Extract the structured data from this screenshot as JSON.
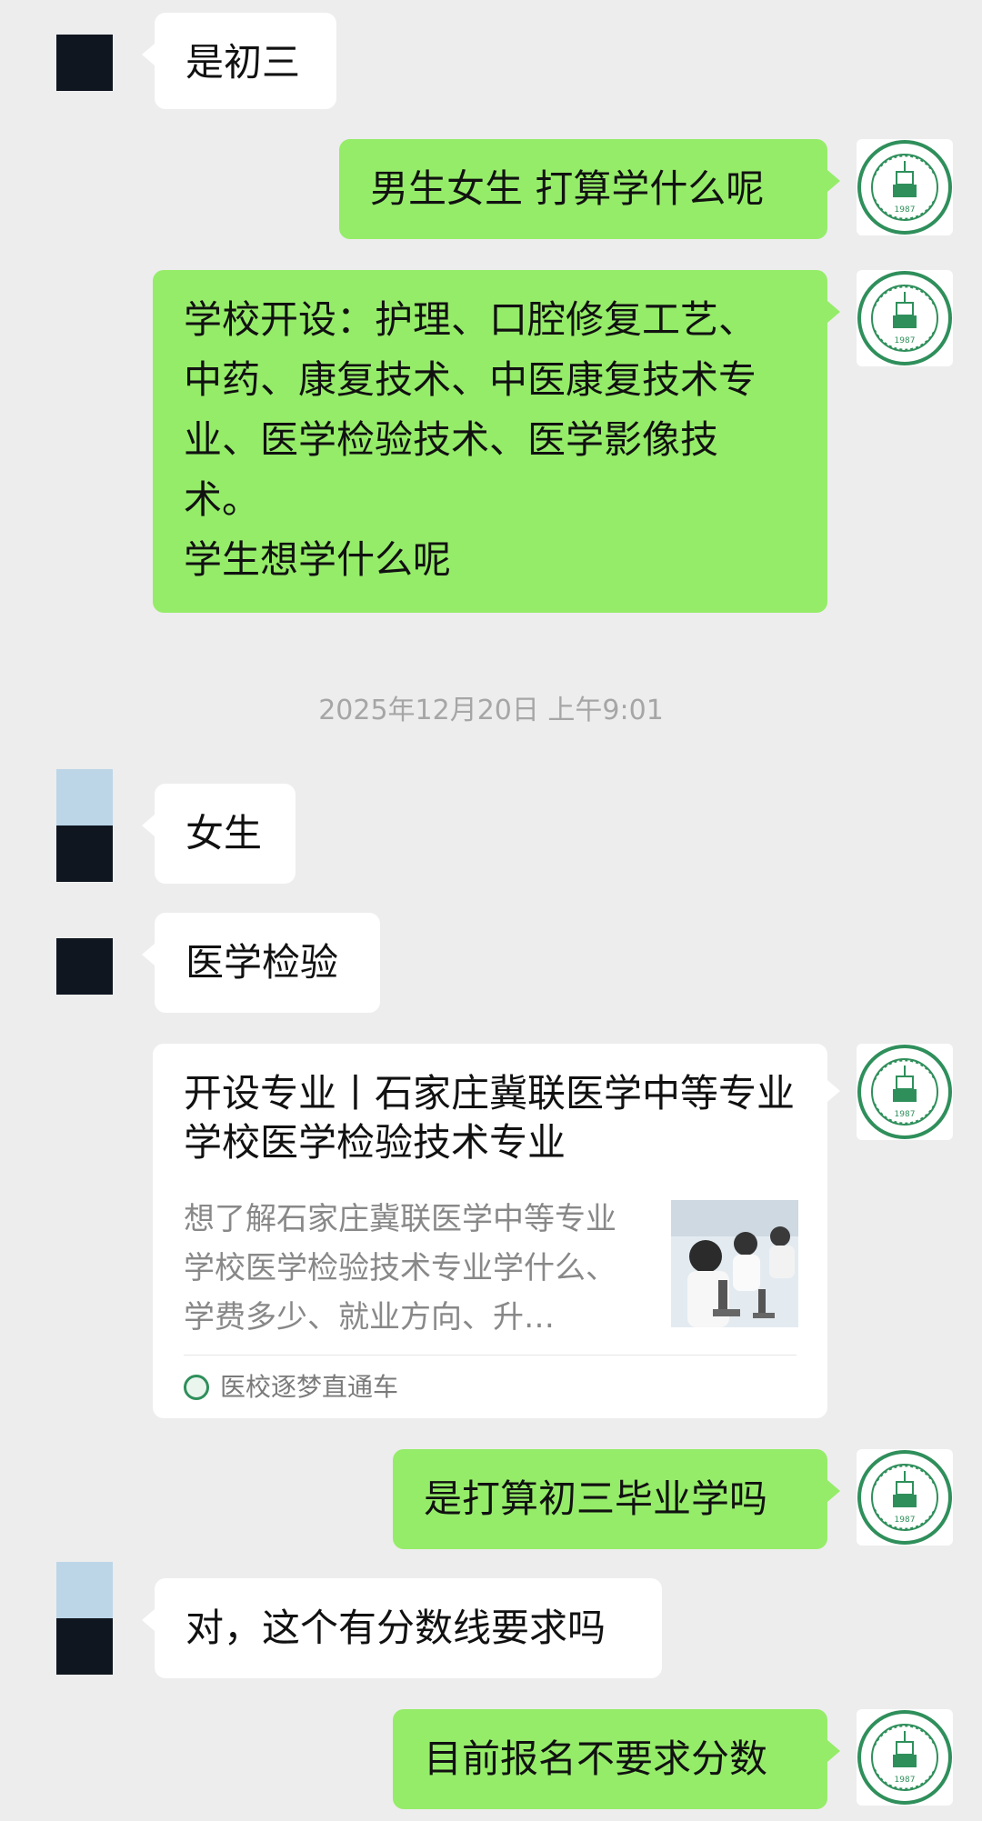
{
  "messages": [
    {
      "text": "是初三"
    },
    {
      "text": "男生女生 打算学什么呢"
    },
    {
      "text": "学校开设：护理、口腔修复工艺、\n中药、康复技术、中医康复技术专\n业、医学检验技术、医学影像技\n术。\n学生想学什么呢"
    },
    {
      "text": "女生"
    },
    {
      "text": "医学检验"
    },
    {
      "text": "是打算初三毕业学吗"
    },
    {
      "text": "对，这个有分数线要求吗"
    },
    {
      "text": "目前报名不要求分数"
    }
  ],
  "timestamp": "2025年12月20日 上午9:01",
  "card": {
    "title": "开设专业丨石家庄冀联医学中等专业学校医学检验技术专业",
    "description": "想了解石家庄冀联医学中等专业学校医学检验技术专业学什么、学费多少、就业方向、升…",
    "source": "医校逐梦直通车"
  },
  "logo": {
    "ring_text": "石家庄冀联医学中等专业学校 Shijiazhuang Jilian Medical Secondary School",
    "year": "1987",
    "color": "#2f8f5b"
  },
  "colors": {
    "green_bubble": "#95ec69",
    "background": "#ededed"
  },
  "icons": {
    "logo": "school-seal-icon",
    "source": "school-seal-icon"
  }
}
